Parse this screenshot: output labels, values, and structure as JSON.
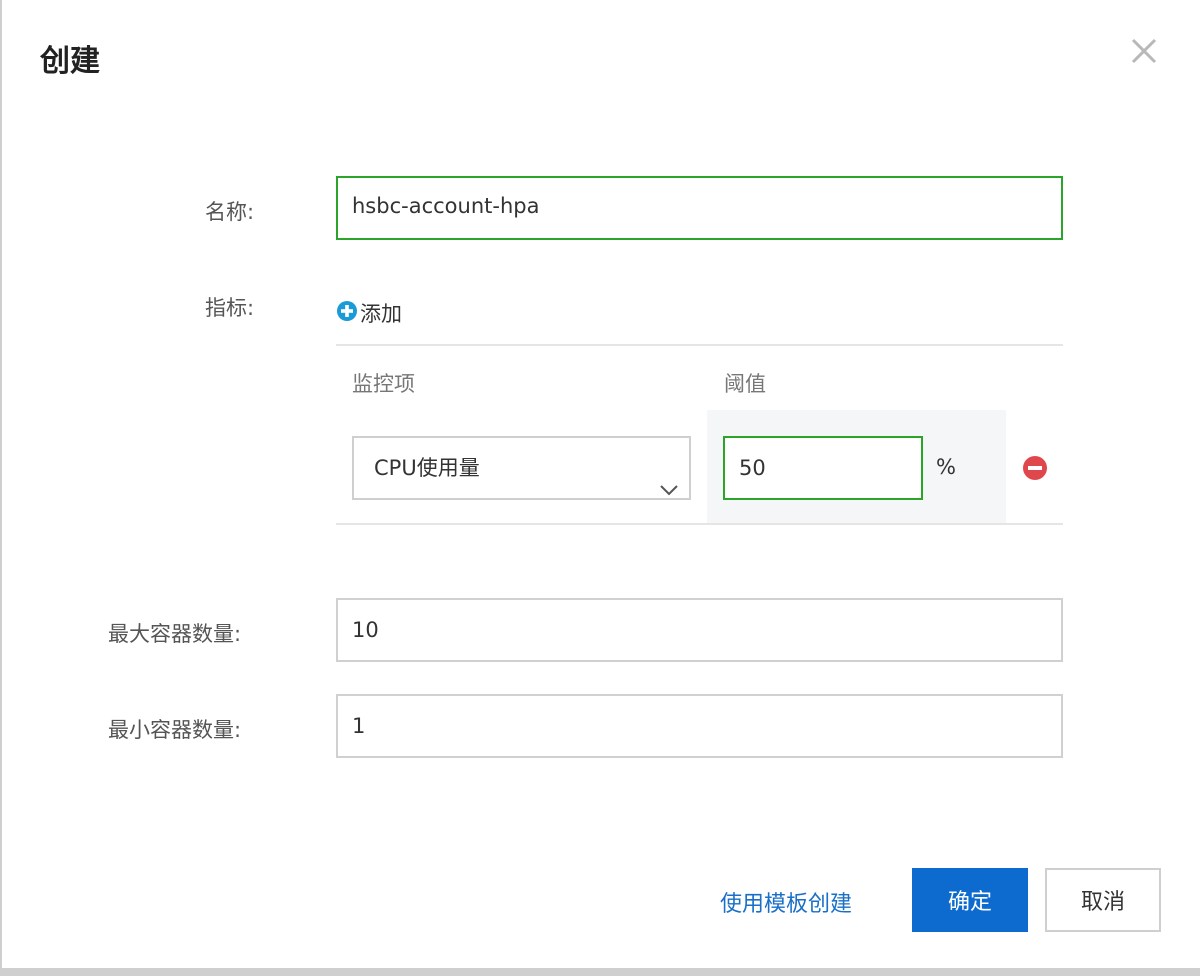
{
  "dialog": {
    "title": "创建"
  },
  "form": {
    "name_label": "名称:",
    "name_value": "hsbc-account-hpa",
    "metrics_label": "指标:",
    "add_label": "添加",
    "metrics_table": {
      "headers": [
        "监控项",
        "阈值"
      ],
      "rows": [
        {
          "metric": "CPU使用量",
          "threshold": "50",
          "unit": "%"
        }
      ]
    },
    "max_label": "最大容器数量:",
    "max_value": "10",
    "min_label": "最小容器数量:",
    "min_value": "1"
  },
  "footer": {
    "template_link": "使用模板创建",
    "ok_label": "确定",
    "cancel_label": "取消"
  },
  "colors": {
    "primary": "#0d6bcf",
    "focus_border": "#2aa52a",
    "add_icon": "#1a9bd7",
    "remove_icon": "#e0474c"
  }
}
